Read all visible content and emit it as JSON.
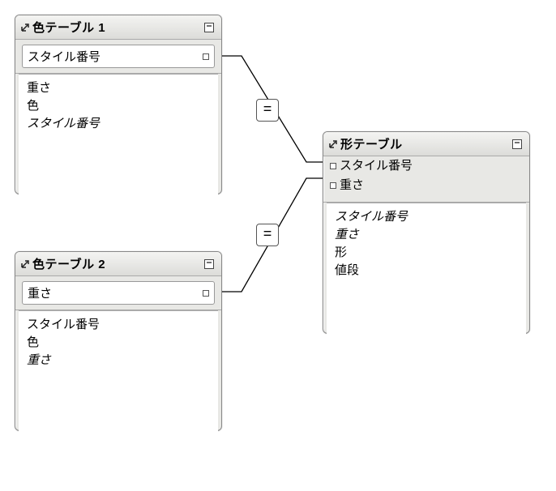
{
  "panel1": {
    "title": "色テーブル 1",
    "keyfield": "スタイル番号",
    "fields": [
      "重さ",
      "色"
    ],
    "fields_italic": [
      "スタイル番号"
    ]
  },
  "panel2": {
    "title": "色テーブル 2",
    "keyfield": "重さ",
    "fields": [
      "スタイル番号",
      "色"
    ],
    "fields_italic": [
      "重さ"
    ]
  },
  "panel3": {
    "title": "形テーブル",
    "target_rows": [
      "スタイル番号",
      "重さ"
    ],
    "fields_italic": [
      "スタイル番号",
      "重さ"
    ],
    "fields": [
      "形",
      "値段"
    ]
  },
  "op1": "=",
  "op2": "="
}
